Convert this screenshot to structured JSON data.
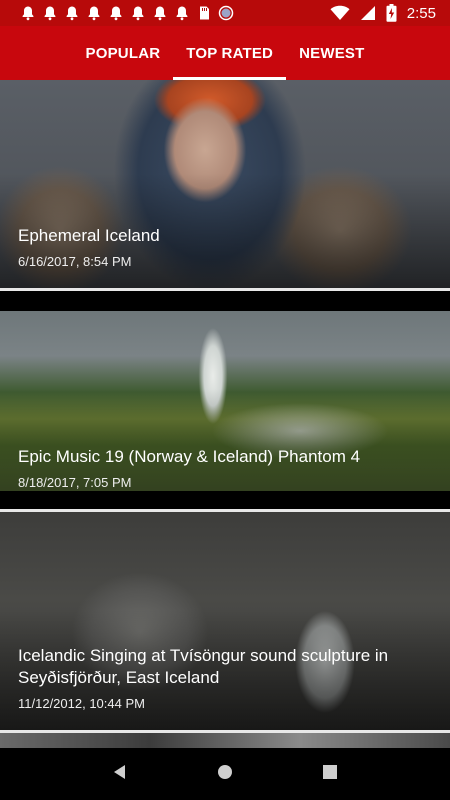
{
  "status_bar": {
    "time": "2:55",
    "notification_icons": [
      "bell-icon",
      "bell-icon",
      "bell-icon",
      "bell-icon",
      "bell-icon",
      "bell-icon",
      "bell-icon",
      "bell-icon",
      "sd-card-icon",
      "circle-icon"
    ]
  },
  "tabs": [
    {
      "label": "POPULAR",
      "active": false
    },
    {
      "label": "TOP RATED",
      "active": true
    },
    {
      "label": "NEWEST",
      "active": false
    }
  ],
  "videos": [
    {
      "title": "Ephemeral Iceland",
      "date": "6/16/2017, 8:54 PM"
    },
    {
      "title": "Epic Music 19 (Norway & Iceland) Phantom 4",
      "date": "8/18/2017, 7:05 PM"
    },
    {
      "title": "Icelandic Singing at  Tvísöngur sound sculpture in Seyðisfjörður, East Iceland",
      "date": "11/12/2012, 10:44 PM"
    }
  ],
  "colors": {
    "status_bar": "#b70a0a",
    "app_bar": "#c8070d",
    "accent": "#ffffff"
  }
}
